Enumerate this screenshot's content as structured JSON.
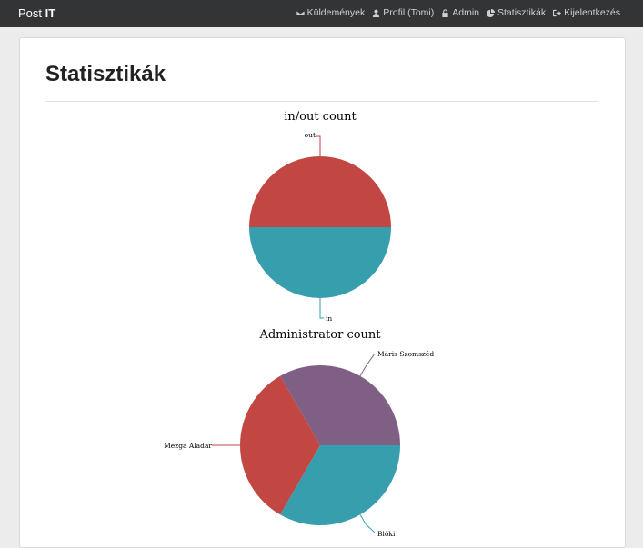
{
  "app": {
    "brand_prefix": "Post ",
    "brand_suffix": "IT"
  },
  "nav": [
    {
      "label": "Küldemények",
      "icon": "envelope-icon"
    },
    {
      "label": "Profil (Tomi)",
      "icon": "user-icon"
    },
    {
      "label": "Admin",
      "icon": "lock-icon"
    },
    {
      "label": "Statisztikák",
      "icon": "pie-chart-icon"
    },
    {
      "label": "Kijelentkezés",
      "icon": "sign-out-icon"
    }
  ],
  "page": {
    "title": "Statisztikák"
  },
  "chart_data": [
    {
      "type": "pie",
      "title": "in/out count",
      "series": [
        {
          "name": "out",
          "value": 1,
          "color": "#c24642"
        },
        {
          "name": "in",
          "value": 1,
          "color": "#369ead"
        }
      ]
    },
    {
      "type": "pie",
      "title": "Administrator count",
      "series": [
        {
          "name": "Máris Szomszéd",
          "value": 1,
          "color": "#7f6084"
        },
        {
          "name": "Blöki",
          "value": 1,
          "color": "#369ead"
        },
        {
          "name": "Mézga Aladár",
          "value": 1,
          "color": "#c24642"
        }
      ]
    }
  ]
}
